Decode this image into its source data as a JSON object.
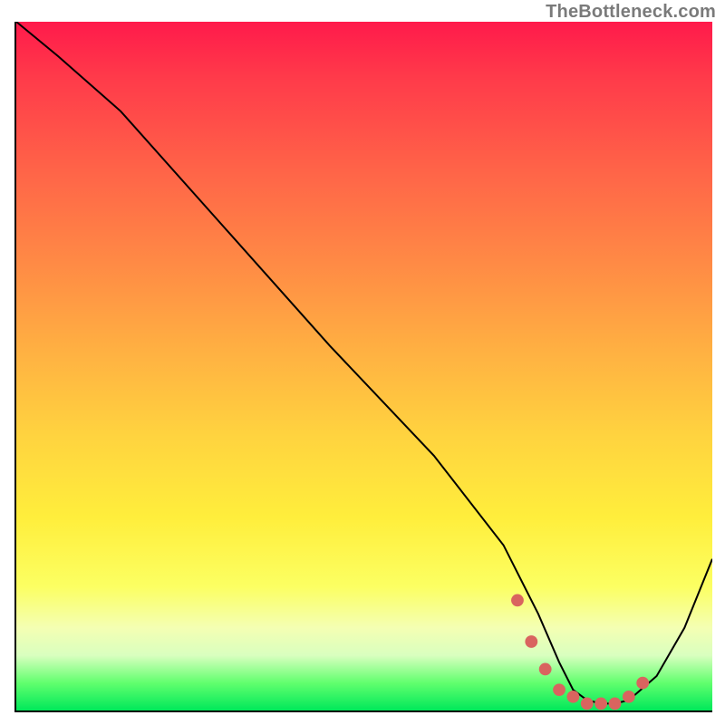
{
  "attribution": "TheBottleneck.com",
  "chart_data": {
    "type": "line",
    "title": "",
    "xlabel": "",
    "ylabel": "",
    "xlim": [
      0,
      100
    ],
    "ylim": [
      0,
      100
    ],
    "grid": false,
    "legend": false,
    "curve": {
      "x": [
        0,
        6,
        15,
        30,
        45,
        60,
        70,
        75,
        78,
        80,
        82,
        84,
        86,
        88,
        92,
        96,
        100
      ],
      "y": [
        100,
        95,
        87,
        70,
        53,
        37,
        24,
        14,
        7,
        3,
        1.5,
        1,
        1,
        1.5,
        5,
        12,
        22
      ]
    },
    "markers": {
      "note": "salmon dots tracing the valley bottom near the x-axis",
      "x": [
        72,
        74,
        76,
        78,
        80,
        82,
        84,
        86,
        88,
        90
      ],
      "y": [
        16,
        10,
        6,
        3,
        2,
        1,
        1,
        1,
        2,
        4
      ]
    },
    "background_gradient_stops": [
      {
        "pos": 0,
        "color": "#ff1a4b"
      },
      {
        "pos": 22,
        "color": "#ff6548"
      },
      {
        "pos": 48,
        "color": "#ffb142"
      },
      {
        "pos": 72,
        "color": "#ffee3c"
      },
      {
        "pos": 92,
        "color": "#d9ffbf"
      },
      {
        "pos": 100,
        "color": "#00e85a"
      }
    ]
  }
}
